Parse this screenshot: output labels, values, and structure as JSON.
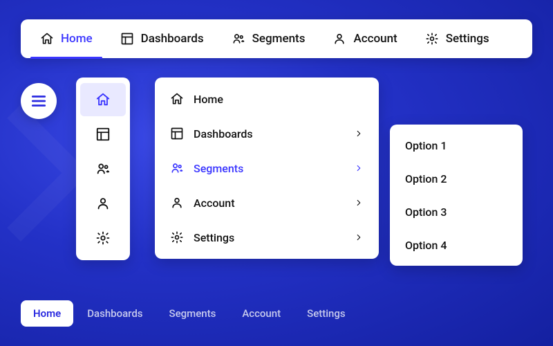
{
  "topnav": {
    "items": [
      {
        "label": "Home",
        "icon": "home",
        "active": true
      },
      {
        "label": "Dashboards",
        "icon": "dashboard",
        "active": false
      },
      {
        "label": "Segments",
        "icon": "segments",
        "active": false
      },
      {
        "label": "Account",
        "icon": "account",
        "active": false
      },
      {
        "label": "Settings",
        "icon": "settings",
        "active": false
      }
    ]
  },
  "sidebar_icons": {
    "items": [
      {
        "icon": "home",
        "active": true
      },
      {
        "icon": "dashboard",
        "active": false
      },
      {
        "icon": "segments",
        "active": false
      },
      {
        "icon": "account",
        "active": false
      },
      {
        "icon": "settings",
        "active": false
      }
    ]
  },
  "menu": {
    "items": [
      {
        "label": "Home",
        "icon": "home",
        "has_children": false,
        "active": false
      },
      {
        "label": "Dashboards",
        "icon": "dashboard",
        "has_children": true,
        "active": false
      },
      {
        "label": "Segments",
        "icon": "segments",
        "has_children": true,
        "active": true
      },
      {
        "label": "Account",
        "icon": "account",
        "has_children": true,
        "active": false
      },
      {
        "label": "Settings",
        "icon": "settings",
        "has_children": true,
        "active": false
      }
    ]
  },
  "submenu": {
    "items": [
      {
        "label": "Option 1"
      },
      {
        "label": "Option 2"
      },
      {
        "label": "Option 3"
      },
      {
        "label": "Option 4"
      }
    ]
  },
  "bottom_tabs": {
    "items": [
      {
        "label": "Home",
        "active": true
      },
      {
        "label": "Dashboards",
        "active": false
      },
      {
        "label": "Segments",
        "active": false
      },
      {
        "label": "Account",
        "active": false
      },
      {
        "label": "Settings",
        "active": false
      }
    ]
  },
  "colors": {
    "accent": "#3b36ff",
    "panel_bg": "#ffffff"
  }
}
